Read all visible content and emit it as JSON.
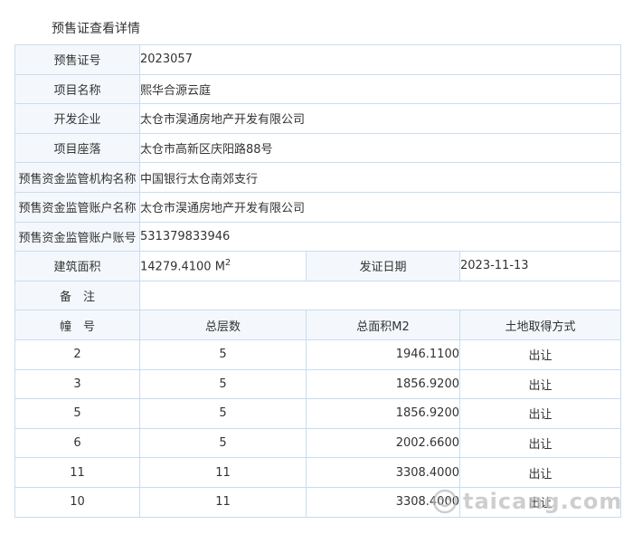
{
  "page": {
    "title": "预售证查看详情"
  },
  "fields": {
    "permit_no": {
      "label": "预售证号",
      "value": "2023057"
    },
    "project_name": {
      "label": "项目名称",
      "value": "熙华合源云庭"
    },
    "developer": {
      "label": "开发企业",
      "value": "太仓市淏通房地产开发有限公司"
    },
    "location": {
      "label": "项目座落",
      "value": "太仓市高新区庆阳路88号"
    },
    "supervision_org": {
      "label": "预售资金监管机构名称",
      "value": "中国银行太仓南郊支行"
    },
    "supervision_account_name": {
      "label": "预售资金监管账户名称",
      "value": "太仓市淏通房地产开发有限公司"
    },
    "supervision_account_no": {
      "label": "预售资金监管账户账号",
      "value": "531379833946"
    },
    "building_area": {
      "label": "建筑面积",
      "value": "14279.4100 M",
      "unit_sup": "2"
    },
    "issue_date": {
      "label": "发证日期",
      "value": "2023-11-13"
    },
    "remarks": {
      "label": "备　注",
      "value": ""
    }
  },
  "buildings": {
    "columns": [
      "幢　号",
      "总层数",
      "总面积M2",
      "土地取得方式"
    ],
    "rows": [
      {
        "building_no": "2",
        "floors": "5",
        "area": "1946.1100",
        "land_method": "出让"
      },
      {
        "building_no": "3",
        "floors": "5",
        "area": "1856.9200",
        "land_method": "出让"
      },
      {
        "building_no": "5",
        "floors": "5",
        "area": "1856.9200",
        "land_method": "出让"
      },
      {
        "building_no": "6",
        "floors": "5",
        "area": "2002.6600",
        "land_method": "出让"
      },
      {
        "building_no": "11",
        "floors": "11",
        "area": "3308.4000",
        "land_method": "出让"
      },
      {
        "building_no": "10",
        "floors": "11",
        "area": "3308.4000",
        "land_method": "出让"
      }
    ]
  },
  "watermark": {
    "text": "taicang.com",
    "icon": "smiley-icon"
  }
}
